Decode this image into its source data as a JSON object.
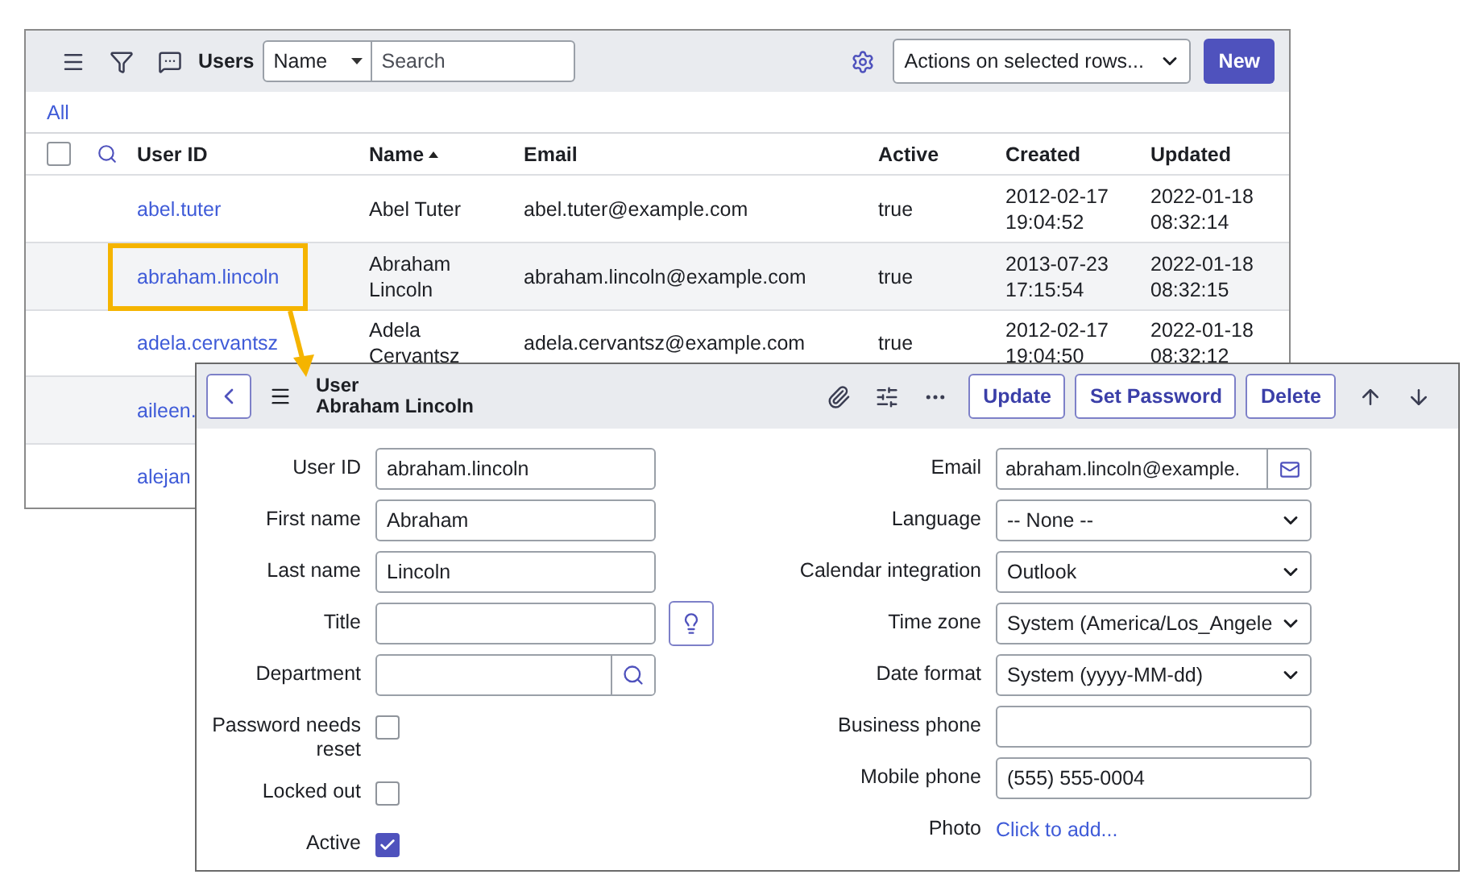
{
  "list": {
    "toolbar": {
      "title": "Users",
      "field_select": "Name",
      "search": {
        "placeholder": "Search"
      },
      "actions": "Actions on selected rows...",
      "new_button": "New"
    },
    "filter": "All",
    "select_all": {
      "checked": false
    },
    "columns": [
      {
        "label": "User ID",
        "sorted": false
      },
      {
        "label": "Name",
        "sorted": true
      },
      {
        "label": "Email",
        "sorted": false
      },
      {
        "label": "Active",
        "sorted": false
      },
      {
        "label": "Created",
        "sorted": false
      },
      {
        "label": "Updated",
        "sorted": false
      }
    ],
    "rows": [
      {
        "cells": [
          "abel.tuter",
          "Abel Tuter",
          "abel.tuter@example.com",
          "true",
          "2012-02-17 19:04:52",
          "2022-01-18 08:32:14"
        ],
        "highlighted": false
      },
      {
        "cells": [
          "abraham.lincoln",
          "Abraham Lincoln",
          "abraham.lincoln@example.com",
          "true",
          "2013-07-23 17:15:54",
          "2022-01-18 08:32:15"
        ],
        "highlighted": true
      },
      {
        "cells": [
          "adela.cervantsz",
          "Adela Cervantsz",
          "adela.cervantsz@example.com",
          "true",
          "2012-02-17 19:04:50",
          "2022-01-18 08:32:12"
        ],
        "highlighted": false
      },
      {
        "cells": [
          "aileen."
        ],
        "highlighted": false
      },
      {
        "cells": [
          "alejan"
        ],
        "highlighted": false
      }
    ]
  },
  "form": {
    "header": {
      "title": "User",
      "subtitle": "Abraham Lincoln",
      "buttons": [
        "Update",
        "Set Password",
        "Delete"
      ]
    },
    "left_fields": [
      {
        "label": "User ID",
        "kind": "text",
        "value": "abraham.lincoln"
      },
      {
        "label": "First name",
        "kind": "text",
        "value": "Abraham"
      },
      {
        "label": "Last name",
        "kind": "text",
        "value": "Lincoln"
      },
      {
        "label": "Title",
        "kind": "suggest"
      },
      {
        "label": "Department",
        "kind": "reference"
      },
      {
        "label": "Password needs reset",
        "kind": "checkbox",
        "checked": false
      },
      {
        "label": "Locked out",
        "kind": "checkbox",
        "checked": false
      },
      {
        "label": "Active",
        "kind": "checkbox",
        "checked": true
      }
    ],
    "right_fields": [
      {
        "label": "Email",
        "kind": "email",
        "value": "abraham.lincoln@example."
      },
      {
        "label": "Language",
        "kind": "select",
        "value": "-- None --"
      },
      {
        "label": "Calendar integration",
        "kind": "select",
        "value": "Outlook"
      },
      {
        "label": "Time zone",
        "kind": "select",
        "value": "System (America/Los_Angele"
      },
      {
        "label": "Date format",
        "kind": "select",
        "value": "System (yyyy-MM-dd)"
      },
      {
        "label": "Business phone",
        "kind": "text"
      },
      {
        "label": "Mobile phone",
        "kind": "text",
        "value": "(555) 555-0004"
      },
      {
        "label": "Photo",
        "kind": "link",
        "value": "Click to add..."
      }
    ]
  }
}
